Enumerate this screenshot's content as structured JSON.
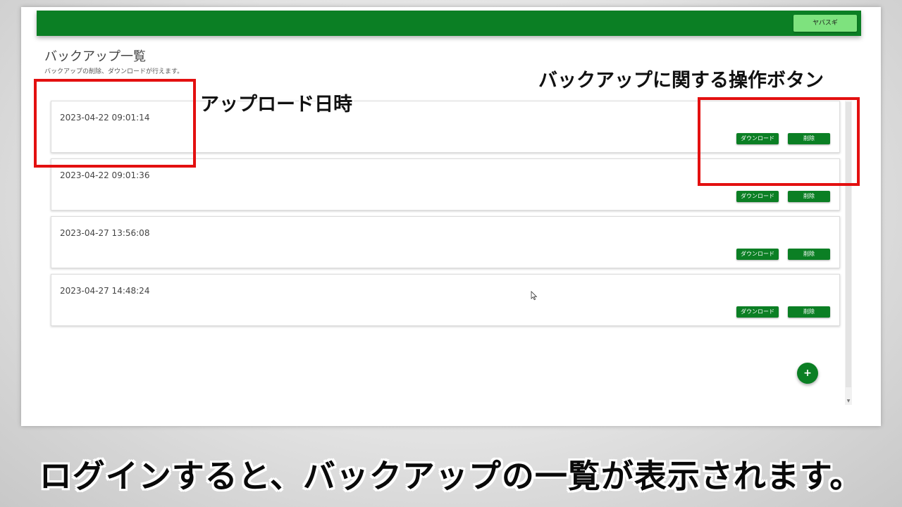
{
  "app": {
    "user_button": "ヤバスギ",
    "page_title": "バックアップ一覧",
    "page_subtitle": "バックアップの削除、ダウンロードが行えます。",
    "fab_label": "+"
  },
  "backups": [
    {
      "datetime": "2023-04-22 09:01:14",
      "download_label": "ダウンロード",
      "delete_label": "削除"
    },
    {
      "datetime": "2023-04-22 09:01:36",
      "download_label": "ダウンロード",
      "delete_label": "削除"
    },
    {
      "datetime": "2023-04-27 13:56:08",
      "download_label": "ダウンロード",
      "delete_label": "削除"
    },
    {
      "datetime": "2023-04-27 14:48:24",
      "download_label": "ダウンロード",
      "delete_label": "削除"
    }
  ],
  "annotations": {
    "upload_datetime": "アップロード日時",
    "action_buttons": "バックアップに関する操作ボタン",
    "highlight_color": "#e31010"
  },
  "caption": "ログインすると、バックアップの一覧が表示されます。",
  "colors": {
    "primary": "#0b7f24",
    "user_button": "#7ee27e"
  }
}
